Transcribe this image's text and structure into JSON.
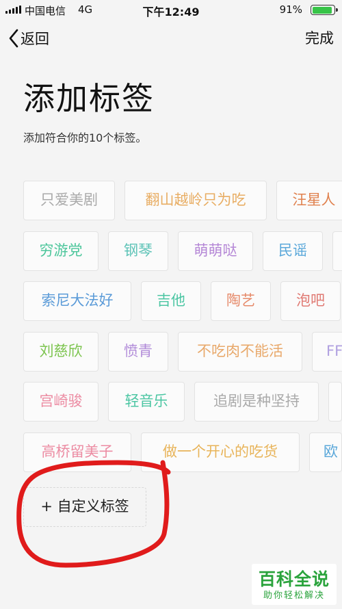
{
  "status_bar": {
    "carrier": "中国电信",
    "network": "4G",
    "time": "下午12:49",
    "battery_percent": "91%",
    "battery_level": 0.91,
    "battery_color": "#37c448"
  },
  "nav": {
    "back_label": "返回",
    "back_icon": "chevron-left-icon",
    "done_label": "完成"
  },
  "page": {
    "title": "添加标签",
    "subtitle": "添加符合你的10个标签。"
  },
  "tag_rows": [
    [
      {
        "label": "只爱美剧",
        "color": "#aaaaaa"
      },
      {
        "label": "翻山越岭只为吃",
        "color": "#e8ad63"
      },
      {
        "label": "汪星人",
        "color": "#e0814e"
      }
    ],
    [
      {
        "label": "穷游党",
        "color": "#4cc69b"
      },
      {
        "label": "钢琴",
        "color": "#5dc3b7"
      },
      {
        "label": "萌萌哒",
        "color": "#b486d6"
      },
      {
        "label": "民谣",
        "color": "#5ba8da"
      }
    ],
    [
      {
        "label": "索尼大法好",
        "color": "#5b9bd8"
      },
      {
        "label": "吉他",
        "color": "#4cc6a3"
      },
      {
        "label": "陶艺",
        "color": "#e68a6a"
      },
      {
        "label": "泡吧",
        "color": "#e07a73"
      }
    ],
    [
      {
        "label": "刘慈欣",
        "color": "#7cc44e"
      },
      {
        "label": "愤青",
        "color": "#b08ad8"
      },
      {
        "label": "不吃肉不能活",
        "color": "#e8a86a"
      },
      {
        "label": "FF",
        "color": "#b0a0e0"
      }
    ],
    [
      {
        "label": "宫崎骏",
        "color": "#ec8ca3"
      },
      {
        "label": "轻音乐",
        "color": "#4cc6a3"
      },
      {
        "label": "追剧是种坚持",
        "color": "#aaaaaa"
      }
    ],
    [
      {
        "label": "高桥留美子",
        "color": "#ec8ca3"
      },
      {
        "label": "做一个开心的吃货",
        "color": "#e8b45a"
      },
      {
        "label": "欧",
        "color": "#5ba8da"
      }
    ]
  ],
  "custom_tag": {
    "label": "+ 自定义标签"
  },
  "annotation": {
    "color": "#e01b1b"
  },
  "watermark": {
    "brand": "百科全说",
    "slogan": "助你轻松解决",
    "color": "#2aa33c"
  }
}
